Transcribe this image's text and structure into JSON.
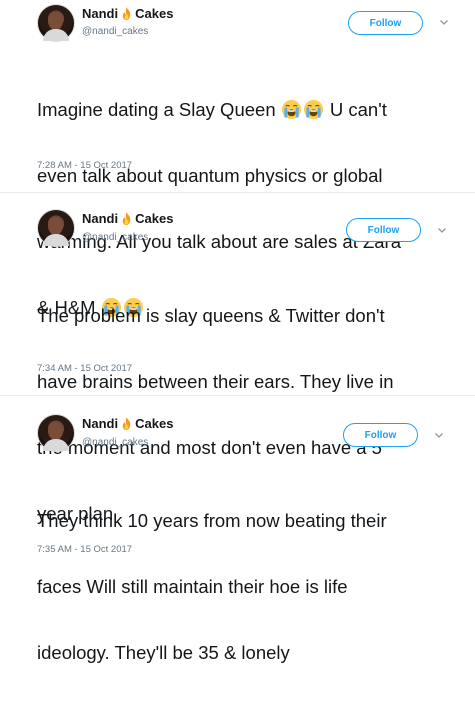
{
  "tweets": [
    {
      "name_part1": "Nandi",
      "name_part2": "Cakes",
      "name_emoji": "fire-icon",
      "handle": "@nandi_cakes",
      "follow_label": "Follow",
      "line1": "Imagine dating a Slay Queen",
      "line1_after": "U can't",
      "line2": "even talk about quantum physics or global",
      "line3": "warming. All you talk about are sales at Zara",
      "line4": "& H&M",
      "text_emoji": "loudly-crying-face-icon",
      "timestamp": "7:28 AM - 15 Oct 2017"
    },
    {
      "name_part1": "Nandi",
      "name_part2": "Cakes",
      "name_emoji": "fire-icon",
      "handle": "@nandi_cakes",
      "follow_label": "Follow",
      "line1": "The problem is slay queens & Twitter don't",
      "line2": "have brains between their ears. They live in",
      "line3": "the moment and most don't even have a 5",
      "line4": "year plan",
      "timestamp": "7:34 AM - 15 Oct 2017"
    },
    {
      "name_part1": "Nandi",
      "name_part2": "Cakes",
      "name_emoji": "fire-icon",
      "handle": "@nandi_cakes",
      "follow_label": "Follow",
      "line1": "They think 10 years from now beating their",
      "line2": "faces Will still maintain their hoe is life",
      "line3": "ideology. They'll be 35 & lonely",
      "timestamp": "7:35 AM - 15 Oct 2017"
    }
  ],
  "colors": {
    "accent": "#1da1f2",
    "secondary_text": "#657786",
    "primary_text": "#14171a",
    "divider": "#e6ecf0"
  }
}
